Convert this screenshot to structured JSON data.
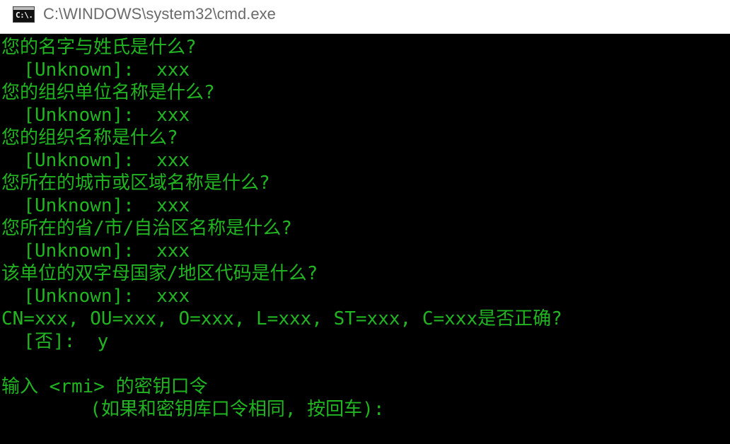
{
  "window": {
    "title": "C:\\WINDOWS\\system32\\cmd.exe",
    "icon": "cmd-icon",
    "icon_glyph": "C:\\.",
    "text_color": "#22b522",
    "background_color": "#000000"
  },
  "console": {
    "lines": [
      "您的名字与姓氏是什么?",
      "  [Unknown]:  xxx",
      "您的组织单位名称是什么?",
      "  [Unknown]:  xxx",
      "您的组织名称是什么?",
      "  [Unknown]:  xxx",
      "您所在的城市或区域名称是什么?",
      "  [Unknown]:  xxx",
      "您所在的省/市/自治区名称是什么?",
      "  [Unknown]:  xxx",
      "该单位的双字母国家/地区代码是什么?",
      "  [Unknown]:  xxx",
      "CN=xxx, OU=xxx, O=xxx, L=xxx, ST=xxx, C=xxx是否正确?",
      "  [否]:  y",
      "",
      "输入 <rmi> 的密钥口令",
      "        (如果和密钥库口令相同, 按回车):"
    ]
  }
}
